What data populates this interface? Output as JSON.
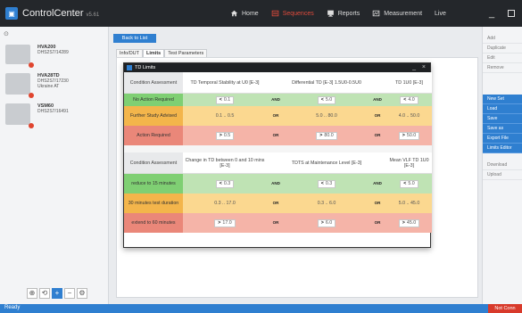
{
  "app": {
    "title": "ControlCenter",
    "version": "v5.61"
  },
  "nav": {
    "home": "Home",
    "sequences": "Sequences",
    "reports": "Reports",
    "measurement": "Measurement",
    "live": "Live"
  },
  "colors": {
    "accent": "#2f7fd0",
    "active_nav": "#e04b3c",
    "status_error": "#d83a2b"
  },
  "devices": [
    {
      "name": "HVA200",
      "serial": "DHS2S7/14289",
      "note": ""
    },
    {
      "name": "HVA28TD",
      "serial": "DHS2S7/17230",
      "note": "Ukraine AT"
    },
    {
      "name": "VSM60",
      "serial": "DHS2S7/16491",
      "note": ""
    }
  ],
  "left_tools": {
    "a": "⊕",
    "b": "⟲",
    "add": "+",
    "remove": "−",
    "settings": "⚙"
  },
  "back_button": "Back to List",
  "tabs": [
    "Info/DUT",
    "Limits",
    "Test Parameters"
  ],
  "right_panel": {
    "group1": [
      "Add",
      "Duplicate",
      "Edit",
      "Remove"
    ],
    "group2": [
      "New Set",
      "Load",
      "Save",
      "Save as",
      "Export File",
      "Limits Editor"
    ],
    "group3": [
      "Download",
      "Upload"
    ]
  },
  "status": {
    "left": "Ready",
    "right": "Not Conn"
  },
  "dialog": {
    "title": "TD Limits",
    "minimize": "_",
    "close": "×",
    "table1": {
      "headers": [
        "Condition Assessment",
        "TD Temporal Stability at U0 [E-3]",
        "Differential TD [E-3] 1.5U0-0.5U0",
        "TD 1U0 [E-3]"
      ],
      "rows": [
        {
          "label": "No Action Required",
          "op1": "AND",
          "op2": "AND",
          "c1": {
            "sym": "<",
            "val": "0.1"
          },
          "c2": {
            "sym": "<",
            "val": "5.0"
          },
          "c3": {
            "sym": "<",
            "val": "4.0"
          }
        },
        {
          "label": "Further Study Advised",
          "op1": "OR",
          "op2": "OR",
          "c1": {
            "sym": "",
            "val": "0.1 .. 0.5"
          },
          "c2": {
            "sym": "",
            "val": "5.0 .. 80.0"
          },
          "c3": {
            "sym": "",
            "val": "4.0 .. 50.0"
          }
        },
        {
          "label": "Action Required",
          "op1": "OR",
          "op2": "OR",
          "c1": {
            "sym": ">",
            "val": "0.5"
          },
          "c2": {
            "sym": ">",
            "val": "80.0"
          },
          "c3": {
            "sym": ">",
            "val": "50.0"
          }
        }
      ]
    },
    "table2": {
      "headers": [
        "Condition Assessment",
        "Change in TD between 0 and 10 mins [E-3]",
        "TDTS at Maintenance Level [E-3]",
        "Mean VLF TD 1U0 [E-3]"
      ],
      "rows": [
        {
          "label": "reduce to 15 minutes",
          "op1": "AND",
          "op2": "AND",
          "c1": {
            "sym": "<",
            "val": "0.3"
          },
          "c2": {
            "sym": "<",
            "val": "0.3"
          },
          "c3": {
            "sym": "<",
            "val": "5.0"
          }
        },
        {
          "label": "30 minutes test duration",
          "op1": "OR",
          "op2": "OR",
          "c1": {
            "sym": "",
            "val": "0.3 .. 17.0"
          },
          "c2": {
            "sym": "",
            "val": "0.3 .. 6.0"
          },
          "c3": {
            "sym": "",
            "val": "5.0 .. 45.0"
          }
        },
        {
          "label": "extend to 60 minutes",
          "op1": "OR",
          "op2": "OR",
          "c1": {
            "sym": ">",
            "val": "17.0"
          },
          "c2": {
            "sym": ">",
            "val": "6.0"
          },
          "c3": {
            "sym": ">",
            "val": "45.0"
          }
        }
      ]
    }
  }
}
